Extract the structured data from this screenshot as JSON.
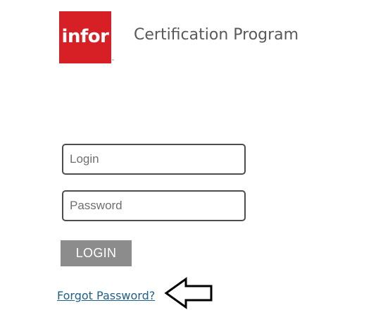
{
  "brand": {
    "logo_text": "infor",
    "trademark": "™",
    "logo_color": "#d71f26",
    "program_title": "Certification Program"
  },
  "form": {
    "login_placeholder": "Login",
    "password_placeholder": "Password",
    "login_value": "",
    "password_value": "",
    "submit_label": "LOGIN",
    "forgot_label": "Forgot Password?"
  },
  "annotation": {
    "icon": "left-arrow-icon"
  }
}
